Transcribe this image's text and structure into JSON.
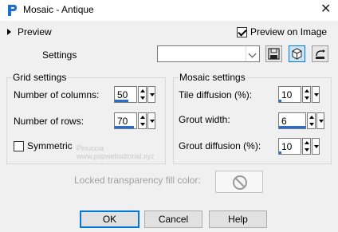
{
  "window": {
    "title": "Mosaic - Antique",
    "close_glyph": "✕"
  },
  "preview": {
    "label": "Preview",
    "preview_on_image_label": "Preview on Image",
    "preview_on_image_checked": true
  },
  "settings": {
    "label": "Settings",
    "preset_value": ""
  },
  "grid": {
    "title": "Grid settings",
    "columns_label": "Number of columns:",
    "columns_value": "50",
    "rows_label": "Number of rows:",
    "rows_value": "70",
    "symmetric_label": "Symmetric",
    "symmetric_checked": false
  },
  "mosaic": {
    "title": "Mosaic settings",
    "tile_label": "Tile diffusion (%):",
    "tile_value": "10",
    "grout_width_label": "Grout width:",
    "grout_width_value": "6",
    "grout_diffusion_label": "Grout diffusion (%):",
    "grout_diffusion_value": "10"
  },
  "locked": {
    "label": "Locked transparency fill color:"
  },
  "watermark": {
    "line1": "Pinuccia",
    "line2": "www.pspwebsdtorial.xyz"
  },
  "buttons": {
    "ok": "OK",
    "cancel": "Cancel",
    "help": "Help"
  },
  "colors": {
    "accent": "#0078d7",
    "spin_bar": "#2a6bcf"
  }
}
